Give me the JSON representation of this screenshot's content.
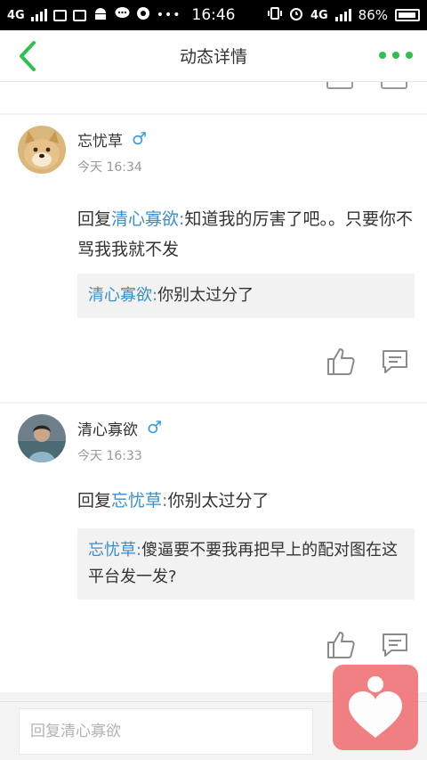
{
  "statusbar": {
    "network": "4G",
    "time": "16:46",
    "network_right": "4G",
    "battery": "86%"
  },
  "navbar": {
    "title": "动态详情"
  },
  "comments": [
    {
      "name": "忘忧草",
      "gender_icon": "♂",
      "time": "今天 16:34",
      "reply_prefix": "回复",
      "reply_to": "清心寡欲",
      "colon": ":",
      "text": "知道我的厉害了吧。。只要你不骂我我就不发",
      "quote_author": "清心寡欲",
      "quote_colon": ":",
      "quote_text": "你别太过分了"
    },
    {
      "name": "清心寡欲",
      "gender_icon": "♂",
      "time": "今天 16:33",
      "reply_prefix": "回复",
      "reply_to": "忘忧草",
      "colon": ":",
      "text": "你别太过分了",
      "quote_author": "忘忧草",
      "quote_colon": ":",
      "quote_text": "傻逼要不要我再把早上的配对图在这平台发一发?"
    }
  ],
  "reply": {
    "placeholder": "回复清心寡欲"
  },
  "colors": {
    "accent": "#2fbf4e",
    "link": "#3a8ec9",
    "male": "#3a9ad9",
    "float_button": "#f06f73"
  }
}
